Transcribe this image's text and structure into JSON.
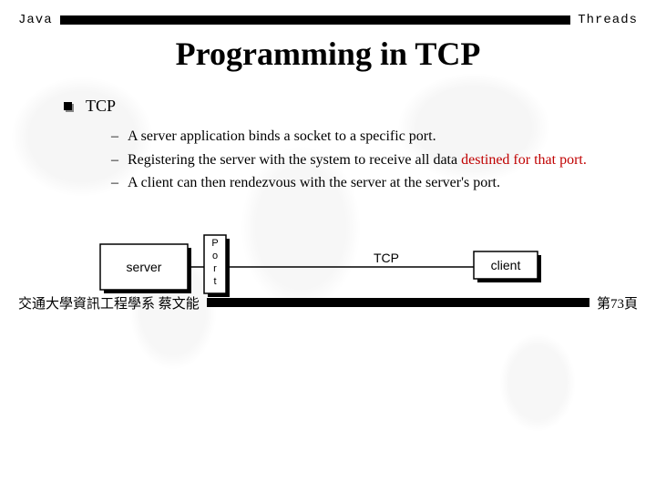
{
  "header": {
    "left": "Java",
    "right": "Threads"
  },
  "title": "Programming in TCP",
  "bullet": {
    "label": "TCP",
    "subs": [
      {
        "plain": "A server application binds a socket to a specific port."
      },
      {
        "plain_prefix": "Registering the server with the system to receive all data ",
        "red": "destined for that port."
      },
      {
        "plain": "A client can then rendezvous with the server at the server's port."
      }
    ]
  },
  "diagram": {
    "server_label": "server",
    "port_label": "Port",
    "tcp_label": "TCP",
    "client_label": "client"
  },
  "footer": {
    "left": "交通大學資訊工程學系 蔡文能",
    "right": "第73頁"
  }
}
